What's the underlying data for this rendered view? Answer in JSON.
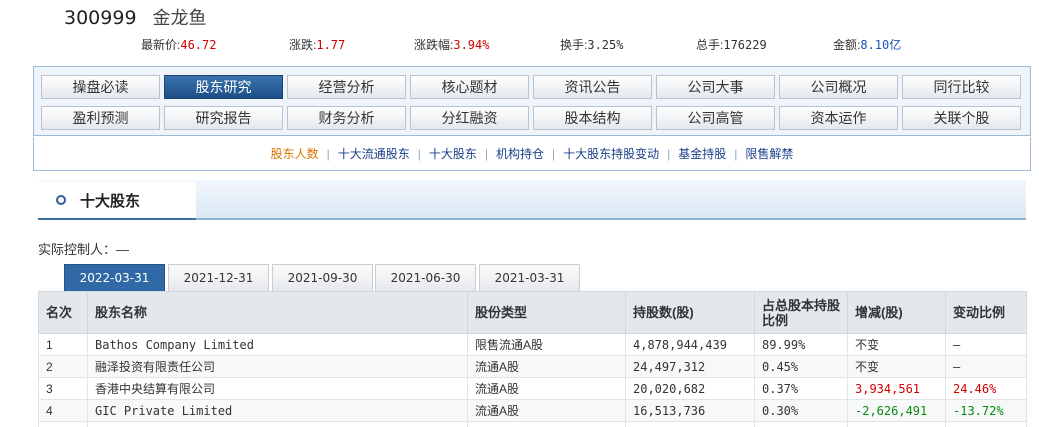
{
  "stock": {
    "code": "300999",
    "name": "金龙鱼"
  },
  "quote": [
    {
      "label": "最新价:",
      "value": "46.72",
      "color": "red"
    },
    {
      "label": "涨跌:",
      "value": "1.77",
      "color": "red"
    },
    {
      "label": "涨跌幅:",
      "value": "3.94%",
      "color": "red"
    },
    {
      "label": "换手:",
      "value": "3.25%",
      "color": "gray"
    },
    {
      "label": "总手:",
      "value": "176229",
      "color": "gray"
    },
    {
      "label": "金额:",
      "value": "8.10亿",
      "color": "blue"
    }
  ],
  "nav": {
    "row1": [
      "操盘必读",
      "股东研究",
      "经营分析",
      "核心题材",
      "资讯公告",
      "公司大事",
      "公司概况",
      "同行比较"
    ],
    "row2": [
      "盈利预测",
      "研究报告",
      "财务分析",
      "分红融资",
      "股本结构",
      "公司高管",
      "资本运作",
      "关联个股"
    ],
    "active": "股东研究"
  },
  "subnav": {
    "items": [
      "股东人数",
      "十大流通股东",
      "十大股东",
      "机构持仓",
      "十大股东持股变动",
      "基金持股",
      "限售解禁"
    ],
    "active": "股东人数"
  },
  "section": {
    "title": "十大股东",
    "controller": "实际控制人：—"
  },
  "date_tabs": {
    "items": [
      "2022-03-31",
      "2021-12-31",
      "2021-09-30",
      "2021-06-30",
      "2021-03-31"
    ],
    "active": "2022-03-31"
  },
  "table": {
    "headers": [
      "名次",
      "股东名称",
      "股份类型",
      "持股数(股)",
      "占总股本持股比例",
      "增减(股)",
      "变动比例"
    ],
    "rows": [
      {
        "rank": "1",
        "name": "Bathos Company Limited",
        "type": "限售流通A股",
        "shares": "4,878,944,439",
        "ratio": "89.99%",
        "change": "不变",
        "change_pct": "—",
        "trend": "none"
      },
      {
        "rank": "2",
        "name": "融泽投资有限责任公司",
        "type": "流通A股",
        "shares": "24,497,312",
        "ratio": "0.45%",
        "change": "不变",
        "change_pct": "—",
        "trend": "none"
      },
      {
        "rank": "3",
        "name": "香港中央结算有限公司",
        "type": "流通A股",
        "shares": "20,020,682",
        "ratio": "0.37%",
        "change": "3,934,561",
        "change_pct": "24.46%",
        "trend": "up"
      },
      {
        "rank": "4",
        "name": "GIC Private Limited",
        "type": "流通A股",
        "shares": "16,513,736",
        "ratio": "0.30%",
        "change": "-2,626,491",
        "change_pct": "-13.72%",
        "trend": "down"
      }
    ]
  },
  "colors": {
    "red": "#d40000",
    "green": "#0a8a0a",
    "blue": "#1a56b8",
    "nav_active": "#2f5f94"
  }
}
